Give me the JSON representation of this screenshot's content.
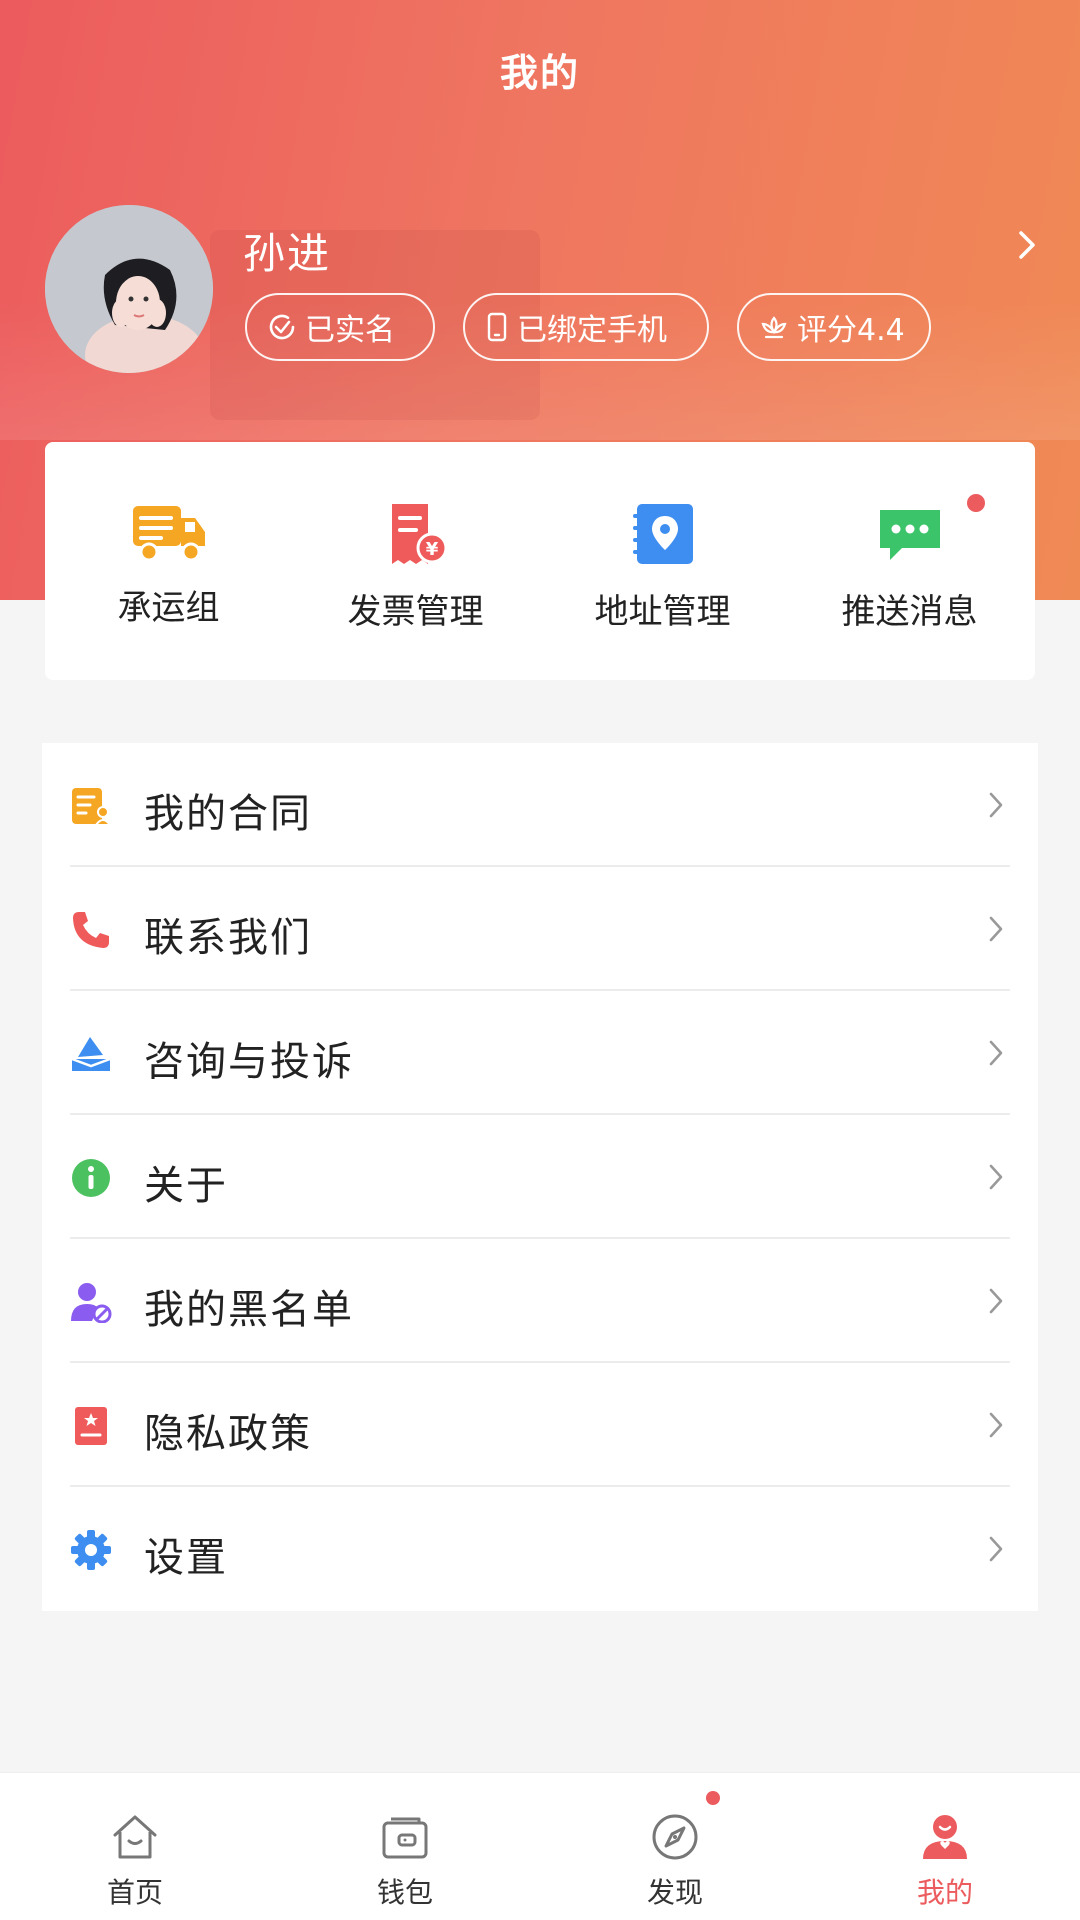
{
  "header": {
    "title": "我的"
  },
  "profile": {
    "name": "孙进",
    "badges": [
      {
        "label": "已实名",
        "icon": "check-circle-icon"
      },
      {
        "label": "已绑定手机",
        "icon": "phone-icon"
      },
      {
        "label": "评分4.4",
        "icon": "lotus-icon"
      }
    ]
  },
  "quick_actions": [
    {
      "label": "承运组",
      "icon": "truck-icon",
      "color": "#f5a623"
    },
    {
      "label": "发票管理",
      "icon": "invoice-icon",
      "color": "#ef5b5b"
    },
    {
      "label": "地址管理",
      "icon": "location-book-icon",
      "color": "#3d8ef0"
    },
    {
      "label": "推送消息",
      "icon": "message-icon",
      "color": "#3cc46b",
      "has_dot": true
    }
  ],
  "menu": [
    {
      "label": "我的合同",
      "icon": "contract-icon",
      "color": "#f5a623"
    },
    {
      "label": "联系我们",
      "icon": "phone-call-icon",
      "color": "#ef5b5b"
    },
    {
      "label": "咨询与投诉",
      "icon": "envelope-icon",
      "color": "#3d8ef0"
    },
    {
      "label": "关于",
      "icon": "info-icon",
      "color": "#4cc160"
    },
    {
      "label": "我的黑名单",
      "icon": "blocked-user-icon",
      "color": "#8a5cf0"
    },
    {
      "label": "隐私政策",
      "icon": "privacy-book-icon",
      "color": "#ef5b5b"
    },
    {
      "label": "设置",
      "icon": "gear-icon",
      "color": "#3d8ef0"
    }
  ],
  "tabbar": {
    "active": 3,
    "accent": "#ec5b5e",
    "items": [
      {
        "label": "首页",
        "icon": "home-icon"
      },
      {
        "label": "钱包",
        "icon": "wallet-icon"
      },
      {
        "label": "发现",
        "icon": "compass-icon",
        "has_dot": true
      },
      {
        "label": "我的",
        "icon": "user-icon"
      }
    ]
  }
}
